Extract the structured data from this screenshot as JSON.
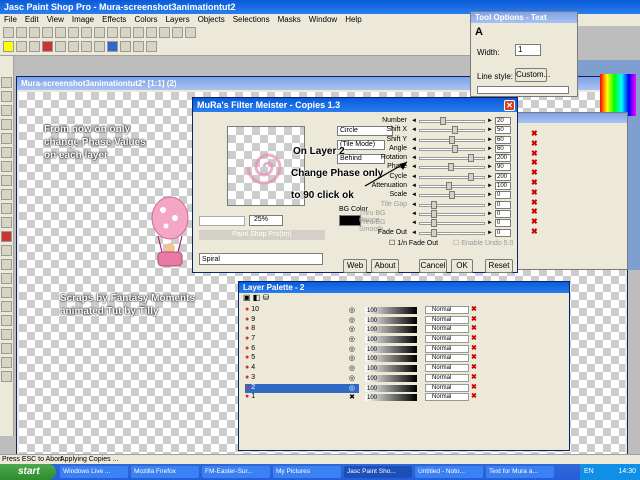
{
  "app": {
    "title": "Jasc Paint Shop Pro - Mura-screenshot3animationtut2",
    "menu": [
      "File",
      "Edit",
      "View",
      "Image",
      "Effects",
      "Colors",
      "Layers",
      "Objects",
      "Selections",
      "Masks",
      "Window",
      "Help"
    ]
  },
  "image_window": {
    "title": "Mura-screenshot3animationtut2* [1:1] (2)"
  },
  "instructions": {
    "line1": "From now on only",
    "line2": "change Phase Values",
    "line3": "on each layer",
    "credit1": "Scraps by Fantasy Moments",
    "credit2": "animated Tut by Tilly"
  },
  "filter": {
    "title": "MuRa's Filter Meister - Copies 1.3",
    "zoom": "25%",
    "brand": "Paint Shop Pro(tm)",
    "spiral": "Spiral",
    "selects": [
      "Circle",
      "(Tile Mode)",
      "Behind"
    ],
    "bg_color_label": "BG Color",
    "annot1": "On Layer 2",
    "annot2": "Change Phase only",
    "annot3": "to 90 click ok",
    "params": [
      {
        "label": "Number",
        "value": "20"
      },
      {
        "label": "Shift X",
        "value": "50"
      },
      {
        "label": "Shift Y",
        "value": "60"
      },
      {
        "label": "Angle",
        "value": "60"
      },
      {
        "label": "Rotation",
        "value": "200"
      },
      {
        "label": "Phase",
        "value": "90"
      },
      {
        "label": "Cycle",
        "value": "200"
      },
      {
        "label": "Attenuation",
        "value": "100"
      },
      {
        "label": "Scale",
        "value": "0"
      },
      {
        "label": "Tile Gap",
        "value": "0"
      },
      {
        "label": "Thru BG Range",
        "value": "0"
      },
      {
        "label": "Thru BG Smooth",
        "value": "0"
      },
      {
        "label": "Fade Out",
        "value": "0"
      }
    ],
    "check1": "1/n Fade Out",
    "check2": "Enable Undo 5.0",
    "buttons": [
      "Web",
      "About",
      "Cancel",
      "OK",
      "Reset"
    ]
  },
  "tool_options": {
    "title": "Tool Options - Text",
    "width_label": "Width:",
    "width_value": "1",
    "line_style_label": "Line style:",
    "custom": "Custom..."
  },
  "layer_palette": {
    "title": "Layer Palette - 2",
    "layers": [
      "10",
      "9",
      "8",
      "7",
      "6",
      "5",
      "4",
      "3",
      "2",
      "1"
    ],
    "opacity": "100",
    "blend": "Normal"
  },
  "status": {
    "left": "Press ESC to Abort",
    "mid": "Applying Copies ..."
  },
  "taskbar": {
    "start": "start",
    "items": [
      "Windows Live ...",
      "Mozilla Firefox",
      "FM-Easter-Sur...",
      "My Pictures",
      "Jasc Paint Sho...",
      "Untitled - Noto...",
      "Text for Mura a..."
    ],
    "lang": "EN",
    "time": "14:30"
  }
}
